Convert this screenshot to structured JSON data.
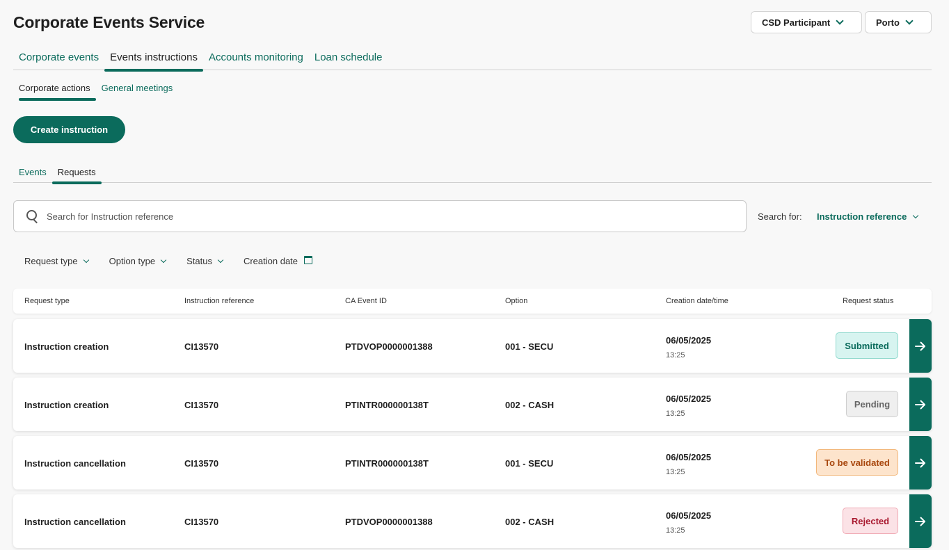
{
  "app": {
    "title": "Corporate Events Service"
  },
  "selectors": {
    "role": "CSD Participant",
    "location": "Porto"
  },
  "main_tabs": [
    "Corporate events",
    "Events instructions",
    "Accounts monitoring",
    "Loan schedule"
  ],
  "active_main_tab": "Events instructions",
  "sub_tabs": [
    "Corporate actions",
    "General meetings"
  ],
  "active_sub_tab": "Corporate actions",
  "create_button": "Create instruction",
  "view_tabs": [
    "Events",
    "Requests"
  ],
  "active_view_tab": "Requests",
  "search": {
    "placeholder": "Search for Instruction reference",
    "for_label": "Search for:",
    "for_value": "Instruction reference"
  },
  "filters": [
    "Request type",
    "Option type",
    "Status",
    "Creation date"
  ],
  "table": {
    "headers": [
      "Request type",
      "Instruction reference",
      "CA Event ID",
      "Option",
      "Creation date/time",
      "Request status"
    ],
    "rows": [
      {
        "request_type": "Instruction creation",
        "instruction_reference": "CI13570",
        "ca_event_id": "PTDVOP0000001388",
        "option": "001 - SECU",
        "date": "06/05/2025",
        "time": "13:25",
        "status": "Submitted"
      },
      {
        "request_type": "Instruction creation",
        "instruction_reference": "CI13570",
        "ca_event_id": "PTINTR000000138T",
        "option": "002 - CASH",
        "date": "06/05/2025",
        "time": "13:25",
        "status": "Pending"
      },
      {
        "request_type": "Instruction cancellation",
        "instruction_reference": "CI13570",
        "ca_event_id": "PTINTR000000138T",
        "option": "001 - SECU",
        "date": "06/05/2025",
        "time": "13:25",
        "status": "To be validated"
      },
      {
        "request_type": "Instruction cancellation",
        "instruction_reference": "CI13570",
        "ca_event_id": "PTDVOP0000001388",
        "option": "002 - CASH",
        "date": "06/05/2025",
        "time": "13:25",
        "status": "Rejected"
      }
    ]
  },
  "colors": {
    "primary": "#0b6b5c",
    "background": "#f8f8f8",
    "submitted": "#d7f4f0",
    "pending": "#efefef",
    "to_be_validated": "#fde4cc",
    "rejected": "#fbe2e6"
  },
  "icons": {
    "dropdown": "chevron-down-icon",
    "search": "search-icon",
    "calendar": "calendar-icon",
    "row_action": "arrow-right-icon"
  }
}
